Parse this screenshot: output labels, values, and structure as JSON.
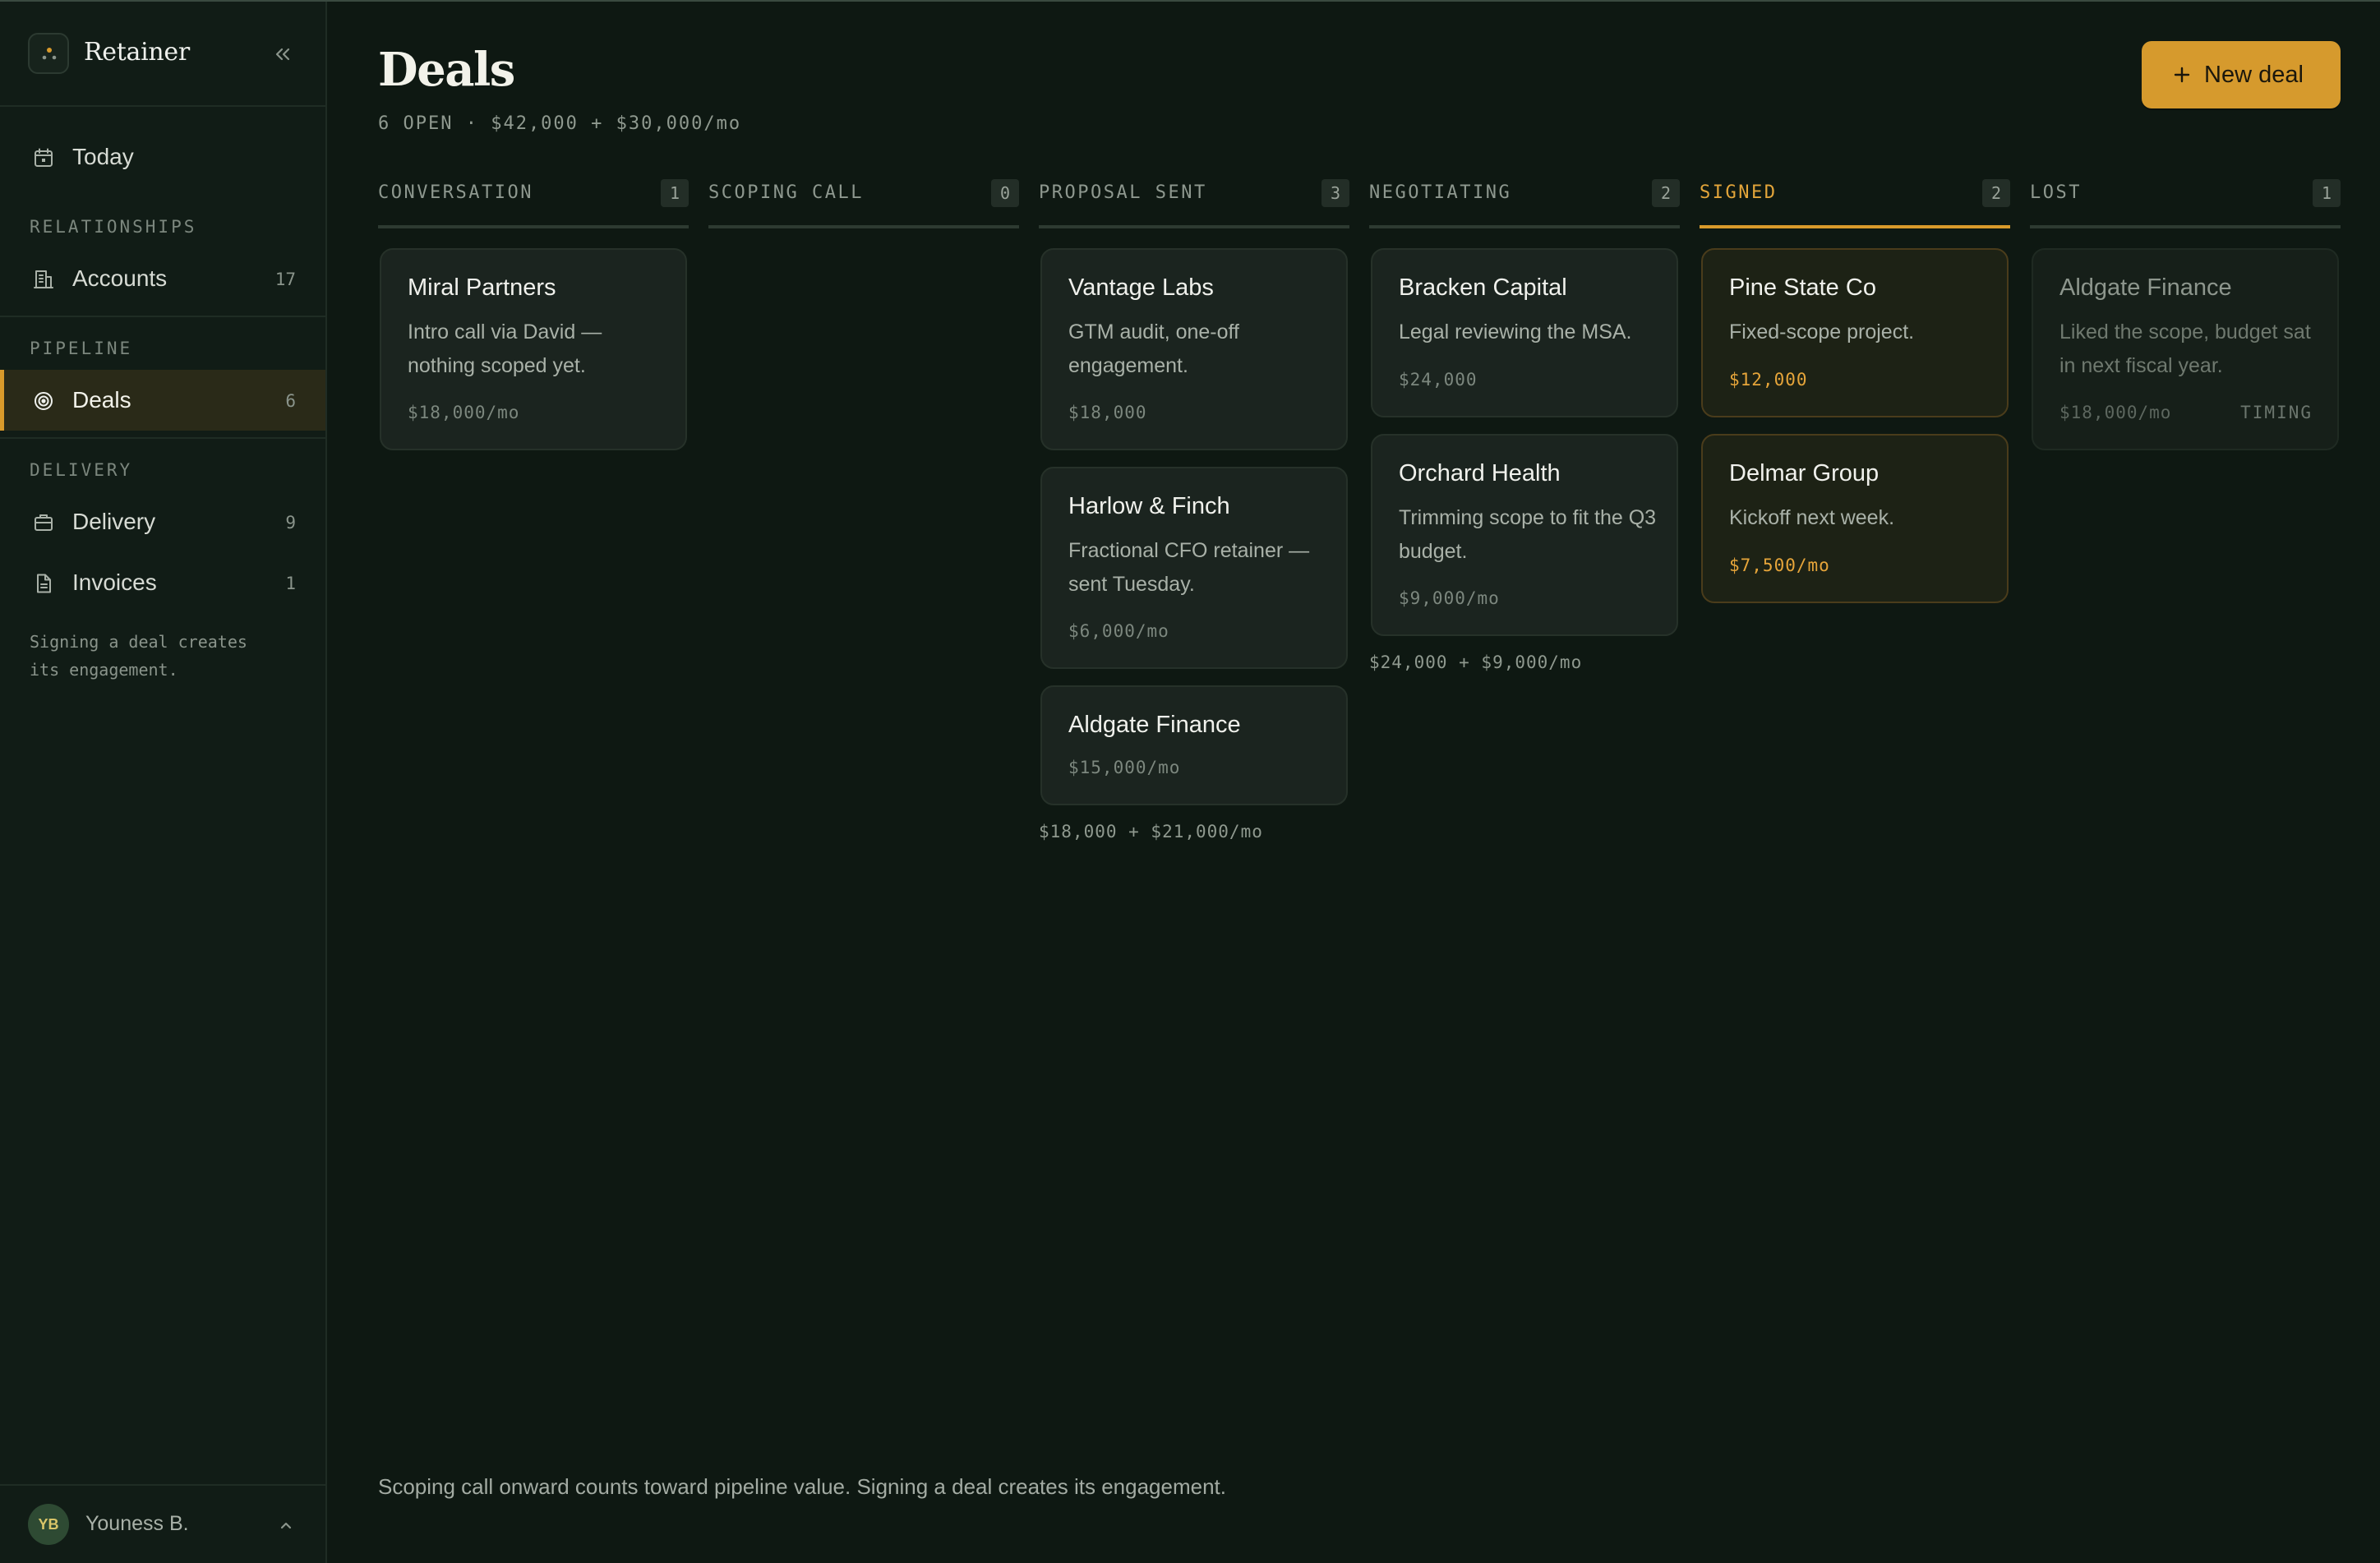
{
  "app": {
    "name": "Retainer",
    "accent": "#d99a2b"
  },
  "sidebar": {
    "today": {
      "label": "Today"
    },
    "sections": {
      "relationships": "RELATIONSHIPS",
      "pipeline": "PIPELINE",
      "delivery": "DELIVERY"
    },
    "items": {
      "accounts": {
        "label": "Accounts",
        "count": "17"
      },
      "deals": {
        "label": "Deals",
        "count": "6"
      },
      "delivery": {
        "label": "Delivery",
        "count": "9"
      },
      "invoices": {
        "label": "Invoices",
        "count": "1"
      }
    },
    "note": "Signing a deal creates its engagement.",
    "user": {
      "initials": "YB",
      "name": "Youness B."
    }
  },
  "header": {
    "title": "Deals",
    "summary": "6 OPEN · $42,000 + $30,000/mo",
    "new_deal_label": "New deal"
  },
  "columns": [
    {
      "name": "CONVERSATION",
      "count": "1",
      "cards": [
        {
          "title": "Miral Partners",
          "desc": "Intro call via David — nothing scoped yet.",
          "value": "$18,000/mo"
        }
      ]
    },
    {
      "name": "SCOPING CALL",
      "count": "0",
      "cards": []
    },
    {
      "name": "PROPOSAL SENT",
      "count": "3",
      "cards": [
        {
          "title": "Vantage Labs",
          "desc": "GTM audit, one-off engagement.",
          "value": "$18,000"
        },
        {
          "title": "Harlow & Finch",
          "desc": "Fractional CFO retainer — sent Tuesday.",
          "value": "$6,000/mo"
        },
        {
          "title": "Aldgate Finance",
          "value": "$15,000/mo"
        }
      ],
      "total": "$18,000 + $21,000/mo"
    },
    {
      "name": "NEGOTIATING",
      "count": "2",
      "cards": [
        {
          "title": "Bracken Capital",
          "desc": "Legal reviewing the MSA.",
          "value": "$24,000"
        },
        {
          "title": "Orchard Health",
          "desc": "Trimming scope to fit the Q3 budget.",
          "value": "$9,000/mo"
        }
      ],
      "total": "$24,000 + $9,000/mo"
    },
    {
      "name": "SIGNED",
      "count": "2",
      "cards": [
        {
          "title": "Pine State Co",
          "desc": "Fixed-scope project.",
          "value": "$12,000"
        },
        {
          "title": "Delmar Group",
          "desc": "Kickoff next week.",
          "value": "$7,500/mo"
        }
      ]
    },
    {
      "name": "LOST",
      "count": "1",
      "cards": [
        {
          "title": "Aldgate Finance",
          "desc": "Liked the scope, budget sat in next fiscal year.",
          "value": "$18,000/mo",
          "tag": "TIMING"
        }
      ]
    }
  ],
  "footer": {
    "note": "Scoping call onward counts toward pipeline value. Signing a deal creates its engagement."
  }
}
